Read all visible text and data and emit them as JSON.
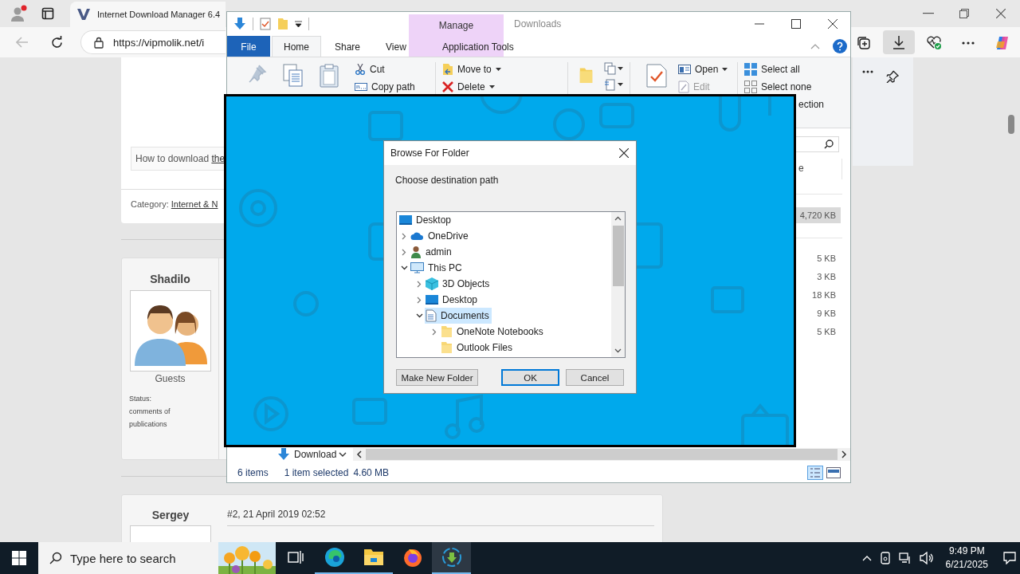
{
  "browser": {
    "tab_title": "Internet Download Manager 6.4",
    "url": "https://vipmolik.net/i"
  },
  "page": {
    "link_box": {
      "text": "How to download ",
      "link": "the"
    },
    "category": {
      "label": "Category: ",
      "link": "Internet & N"
    },
    "comments": [
      {
        "author": "Shadilo",
        "group": "Guests",
        "status_label": "Status:",
        "status_text": "comments of publications"
      },
      {
        "author": "Sergey",
        "meta": "#2, 21 April 2019 02:52"
      }
    ]
  },
  "explorer": {
    "title": "Downloads",
    "context_label": "Manage",
    "tabs": [
      {
        "label": "File",
        "kind": "file",
        "selected": false
      },
      {
        "label": "Home",
        "kind": "tab",
        "selected": true
      },
      {
        "label": "Share",
        "kind": "tab",
        "selected": false
      },
      {
        "label": "View",
        "kind": "tab",
        "selected": false
      },
      {
        "label": "Application Tools",
        "kind": "context",
        "selected": false
      }
    ],
    "clipboard": [
      {
        "label": "Cut",
        "disabled": false,
        "dropdown": false
      },
      {
        "label": "Copy path",
        "disabled": false,
        "dropdown": false
      }
    ],
    "organize": [
      {
        "label": "Move to",
        "disabled": false,
        "dropdown": true
      },
      {
        "label": "Delete",
        "disabled": false,
        "dropdown": true
      }
    ],
    "open": [
      {
        "label": "Open",
        "disabled": false,
        "dropdown": true
      },
      {
        "label": "Edit",
        "disabled": true,
        "dropdown": false
      }
    ],
    "select": [
      "Select all",
      "Select none",
      "ection"
    ],
    "column_fragment": "e",
    "sizes": [
      {
        "text": "4,720 KB",
        "selected": true
      },
      {
        "text": "5 KB",
        "selected": false
      },
      {
        "text": "3 KB",
        "selected": false
      },
      {
        "text": "18 KB",
        "selected": false
      },
      {
        "text": "9 KB",
        "selected": false
      },
      {
        "text": "5 KB",
        "selected": false
      }
    ],
    "nav_item": "Download",
    "status": {
      "count": "6 items",
      "selection": "1 item selected",
      "size": "4.60 MB"
    }
  },
  "dialog": {
    "title": "Browse For Folder",
    "prompt": "Choose destination path",
    "tree": [
      {
        "label": "Desktop",
        "kind": "desktop",
        "selected": false,
        "children": [
          {
            "label": "OneDrive",
            "kind": "cloud",
            "expandable": true,
            "expanded": false,
            "selected": false
          },
          {
            "label": "admin",
            "kind": "user",
            "expandable": true,
            "expanded": false,
            "selected": false
          },
          {
            "label": "This PC",
            "kind": "pc",
            "expandable": true,
            "expanded": true,
            "selected": false,
            "children": [
              {
                "label": "3D Objects",
                "kind": "cube",
                "expandable": true,
                "expanded": false,
                "selected": false
              },
              {
                "label": "Desktop",
                "kind": "desktop",
                "expandable": true,
                "expanded": false,
                "selected": false
              },
              {
                "label": "Documents",
                "kind": "documents",
                "expandable": true,
                "expanded": true,
                "selected": true,
                "children": [
                  {
                    "label": "OneNote Notebooks",
                    "kind": "folder",
                    "expandable": true,
                    "expanded": false,
                    "selected": false
                  },
                  {
                    "label": "Outlook Files",
                    "kind": "folder",
                    "expandable": false,
                    "selected": false
                  }
                ]
              }
            ]
          }
        ]
      }
    ],
    "buttons": [
      {
        "label": "Make New Folder",
        "default": false
      },
      {
        "label": "OK",
        "default": true
      },
      {
        "label": "Cancel",
        "default": false
      }
    ]
  },
  "taskbar": {
    "search_placeholder": "Type here to search",
    "apps": [
      {
        "kind": "taskview",
        "running": false,
        "selected": false
      },
      {
        "kind": "edge",
        "running": true,
        "selected": false
      },
      {
        "kind": "explorer",
        "running": true,
        "selected": false
      },
      {
        "kind": "firefox",
        "running": false,
        "selected": false
      },
      {
        "kind": "idm",
        "running": true,
        "selected": true
      }
    ],
    "time": "9:49 PM",
    "date": "6/21/2025"
  }
}
